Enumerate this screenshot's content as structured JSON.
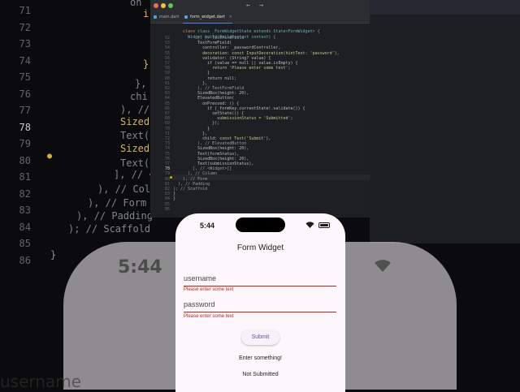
{
  "background": {
    "line_numbers": [
      "71",
      "72",
      "73",
      "74",
      "75",
      "76",
      "77",
      "78",
      "79",
      "80",
      "81",
      "82",
      "83",
      "84",
      "85",
      "86"
    ],
    "active_line": "78",
    "code_fragments": [
      {
        "text": "on",
        "cls": ""
      },
      {
        "text": "i",
        "cls": "ylw"
      },
      {
        "text": "}",
        "cls": "ylw"
      },
      {
        "text": "},",
        "cls": ""
      },
      {
        "text": "chi",
        "cls": ""
      },
      {
        "text": "), //",
        "cls": ""
      },
      {
        "text": "SizedB",
        "cls": "ylw"
      },
      {
        "text": "Text(",
        "cls": ""
      },
      {
        "text": "SizedB",
        "cls": "ylw"
      },
      {
        "text": "Text(s",
        "cls": ""
      },
      {
        "text": "], // <",
        "cls": ""
      },
      {
        "text": "), // Col",
        "cls": ""
      },
      {
        "text": "), // Form",
        "cls": ""
      },
      {
        "text": "), // Padding",
        "cls": ""
      },
      {
        "text": "); // Scaffold",
        "cls": ""
      },
      {
        "text": "}",
        "cls": ""
      },
      {
        "text": "}",
        "cls": ""
      }
    ],
    "phone_time": "5:44",
    "username_text": "username"
  },
  "editor": {
    "tabs": [
      {
        "label": "main.dart",
        "active": false
      },
      {
        "label": "form_widget.dart",
        "active": true
      }
    ],
    "close_glyph": "×",
    "back_arrow": "←",
    "forward_arrow": "→",
    "header_lines": [
      "class _FormWidgetState extends State<FormWidget> {",
      "  Widget build(BuildContext context) {"
    ],
    "line_numbers": [
      "52",
      "53",
      "54",
      "55",
      "56",
      "57",
      "58",
      "59",
      "60",
      "61",
      "62",
      "63",
      "64",
      "65",
      "66",
      "67",
      "68",
      "69",
      "70",
      "71",
      "72",
      "73",
      "74",
      "75",
      "76",
      "77",
      "78",
      "79",
      "80",
      "81",
      "82",
      "83",
      "84",
      "85",
      "86"
    ],
    "active_line": "78",
    "code_lines": [
      "          ), // TextFormField",
      "          TextFormField(",
      "            controller: _passwordController,",
      "            decoration: const InputDecoration(hintText: 'password'),",
      "            validator: (String? value) {",
      "              if (value == null || value.isEmpty) {",
      "                return 'Please enter some text';",
      "              }",
      "              return null;",
      "            },",
      "          ), // TextFormField",
      "          SizedBox(height: 20),",
      "          ElevatedButton(",
      "            onPressed: () {",
      "              if (_formKey.currentState!.validate()) {",
      "                setState(() {",
      "                  submissionStatus = 'Submitted';",
      "                });",
      "              }",
      "            },",
      "            child: const Text('Submit'),",
      "          ), // ElevatedButton",
      "          SizedBox(height: 20),",
      "          Text(formStatus),",
      "          SizedBox(height: 20),",
      "          Text(submissionStatus),",
      "        ], // <Widget>[]",
      "      ), // Column",
      "    ), // Form",
      "  ), // Padding",
      "); // Scaffold",
      "}",
      "}",
      "",
      ""
    ]
  },
  "phone": {
    "time": "5:44",
    "title": "Form Widget",
    "username_placeholder": "username",
    "username_error": "Please enter some text",
    "password_placeholder": "password",
    "password_error": "Please enter some text",
    "submit_label": "Submit",
    "form_status": "Enter something!",
    "submission_status": "Not Submitted"
  },
  "colors": {
    "error": "#b3261e",
    "primary": "#6750a4",
    "surface": "#fdf7fb",
    "editor_bg": "#1e1f22"
  }
}
